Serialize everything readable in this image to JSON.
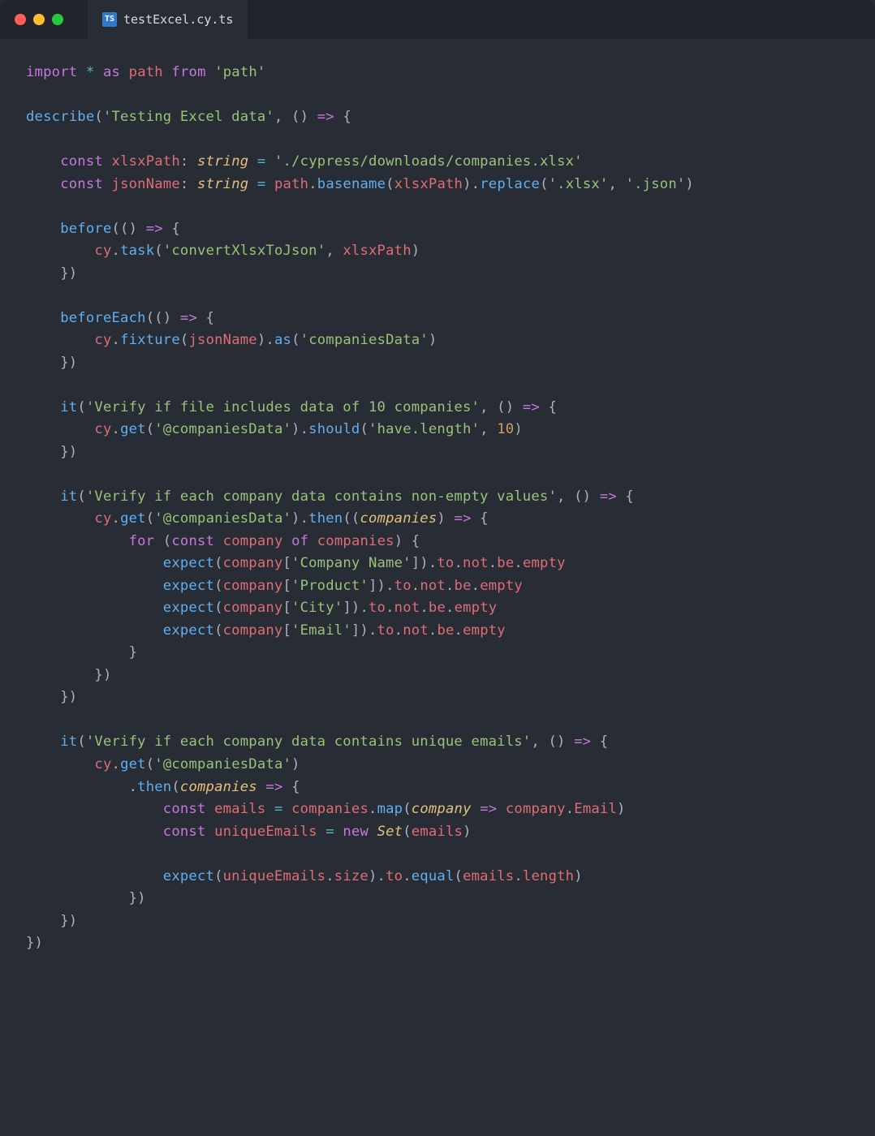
{
  "tab": {
    "icon_label": "TS",
    "filename": "testExcel.cy.ts"
  },
  "code": {
    "line1": {
      "import": "import",
      "star": "*",
      "as": "as",
      "path": "path",
      "from": "from",
      "module": "'path'"
    },
    "line3": {
      "describe": "describe",
      "title": "'Testing Excel data'",
      "arrow": "() => {"
    },
    "line5": {
      "const": "const",
      "name": "xlsxPath",
      "type": "string",
      "eq": "=",
      "val": "'./cypress/downloads/companies.xlsx'"
    },
    "line6": {
      "const": "const",
      "name": "jsonName",
      "type": "string",
      "eq": "=",
      "path": "path",
      "basename": "basename",
      "arg": "xlsxPath",
      "replace": "replace",
      "from": "'.xlsx'",
      "to": "'.json'"
    },
    "line8": {
      "before": "before",
      "arrow": "(() => {"
    },
    "line9": {
      "cy": "cy",
      "task": "task",
      "taskname": "'convertXlsxToJson'",
      "arg": "xlsxPath"
    },
    "line10": {
      "close": "})"
    },
    "line12": {
      "beforeEach": "beforeEach",
      "arrow": "(() => {"
    },
    "line13": {
      "cy": "cy",
      "fixture": "fixture",
      "arg": "jsonName",
      "as": "as",
      "alias": "'companiesData'"
    },
    "line14": {
      "close": "})"
    },
    "line16": {
      "it": "it",
      "title": "'Verify if file includes data of 10 companies'",
      "arrow": "() => {"
    },
    "line17": {
      "cy": "cy",
      "get": "get",
      "alias": "'@companiesData'",
      "should": "should",
      "assert": "'have.length'",
      "num": "10"
    },
    "line18": {
      "close": "})"
    },
    "line20": {
      "it": "it",
      "title": "'Verify if each company data contains non-empty values'",
      "arrow": "() => {"
    },
    "line21": {
      "cy": "cy",
      "get": "get",
      "alias": "'@companiesData'",
      "then": "then",
      "param": "companies",
      "arrow": ") => {"
    },
    "line22": {
      "for": "for",
      "const": "const",
      "var": "company",
      "of": "of",
      "iter": "companies"
    },
    "line23": {
      "expect": "expect",
      "var": "company",
      "key": "'Company Name'",
      "chain": ".to.not.be.empty"
    },
    "line24": {
      "expect": "expect",
      "var": "company",
      "key": "'Product'",
      "chain": ".to.not.be.empty"
    },
    "line25": {
      "expect": "expect",
      "var": "company",
      "key": "'City'",
      "chain": ".to.not.be.empty"
    },
    "line26": {
      "expect": "expect",
      "var": "company",
      "key": "'Email'",
      "chain": ".to.not.be.empty"
    },
    "line27": {
      "close": "}"
    },
    "line28": {
      "close": "})"
    },
    "line29": {
      "close": "})"
    },
    "line31": {
      "it": "it",
      "title": "'Verify if each company data contains unique emails'",
      "arrow": "() => {"
    },
    "line32": {
      "cy": "cy",
      "get": "get",
      "alias": "'@companiesData'"
    },
    "line33": {
      "then": "then",
      "param": "companies",
      "arrow": " => {"
    },
    "line34": {
      "const": "const",
      "name": "emails",
      "eq": "=",
      "src": "companies",
      "map": "map",
      "param": "company",
      "arrow": "=>",
      "obj": "company",
      "prop": "Email"
    },
    "line35": {
      "const": "const",
      "name": "uniqueEmails",
      "eq": "=",
      "new": "new",
      "Set": "Set",
      "arg": "emails"
    },
    "line37": {
      "expect": "expect",
      "var": "uniqueEmails",
      "size": "size",
      "to": "to",
      "equal": "equal",
      "arg": "emails",
      "length": "length"
    },
    "line38": {
      "close": "})"
    },
    "line39": {
      "close": "})"
    },
    "line40": {
      "close": "})"
    }
  }
}
